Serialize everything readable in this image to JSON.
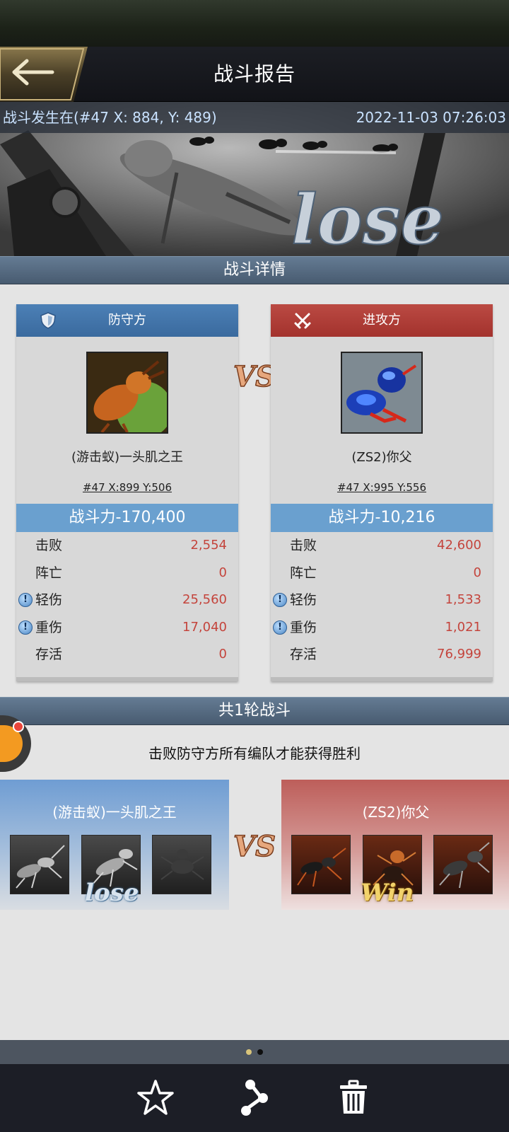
{
  "header": {
    "title": "战斗报告"
  },
  "banner": {
    "location": "战斗发生在(#47 X: 884, Y: 489)",
    "datetime": "2022-11-03 07:26:03",
    "result_word": "lose"
  },
  "detail": {
    "section_title": "战斗详情",
    "vs_text": "VS",
    "defender": {
      "role": "防守方",
      "name": "(游击蚁)一头肌之王",
      "coords": "#47  X:899  Y:506",
      "power": "战斗力-170,400",
      "stats": [
        {
          "label": "击败",
          "value": "2,554"
        },
        {
          "label": "阵亡",
          "value": "0"
        },
        {
          "label": "轻伤",
          "value": "25,560",
          "info": true
        },
        {
          "label": "重伤",
          "value": "17,040",
          "info": true
        },
        {
          "label": "存活",
          "value": "0"
        }
      ]
    },
    "attacker": {
      "role": "进攻方",
      "name": "(ZS2)你父",
      "coords": "#47  X:995  Y:556",
      "power": "战斗力-10,216",
      "stats": [
        {
          "label": "击败",
          "value": "42,600"
        },
        {
          "label": "阵亡",
          "value": "0"
        },
        {
          "label": "轻伤",
          "value": "1,533",
          "info": true
        },
        {
          "label": "重伤",
          "value": "1,021",
          "info": true
        },
        {
          "label": "存活",
          "value": "76,999"
        }
      ]
    }
  },
  "rounds": {
    "section_title": "共1轮战斗",
    "hint": "击败防守方所有编队才能获得胜利",
    "vs_text": "VS",
    "left": {
      "name": "(游击蚁)一头肌之王",
      "result": "lose"
    },
    "right": {
      "name": "(ZS2)你父",
      "result": "Win"
    }
  },
  "pager": {
    "current": 1,
    "total": 2
  },
  "colors": {
    "defender": "#3a6a9e",
    "attacker": "#a3322d",
    "stat_value": "#c4443c",
    "power_bar": "#6aa0cf",
    "section_bar": "#485b70"
  },
  "icons": {
    "back": "left-arrow-icon",
    "defender": "shield-icon",
    "attacker": "crossed-swords-icon",
    "favorite": "star-icon",
    "share": "share-icon",
    "delete": "trash-icon"
  }
}
